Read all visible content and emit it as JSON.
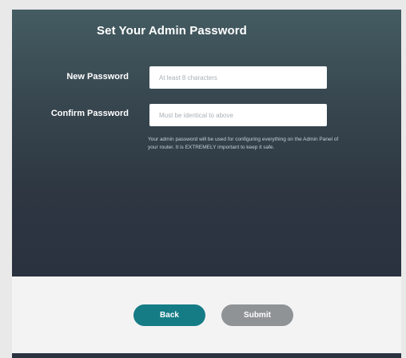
{
  "title": "Set Your Admin Password",
  "form": {
    "new_password_label": "New Password",
    "new_password_placeholder": "At least 8 characters",
    "new_password_value": "",
    "confirm_password_label": "Confirm Password",
    "confirm_password_placeholder": "Must be identical to above",
    "confirm_password_value": "",
    "note": "Your admin password will be used for configuring everything on the Admin Panel of your router. It is EXTREMELY important to keep it safe."
  },
  "buttons": {
    "back_label": "Back",
    "submit_label": "Submit"
  },
  "colors": {
    "accent": "#157c86",
    "disabled": "#8f9396",
    "panel": "#2d3641"
  }
}
